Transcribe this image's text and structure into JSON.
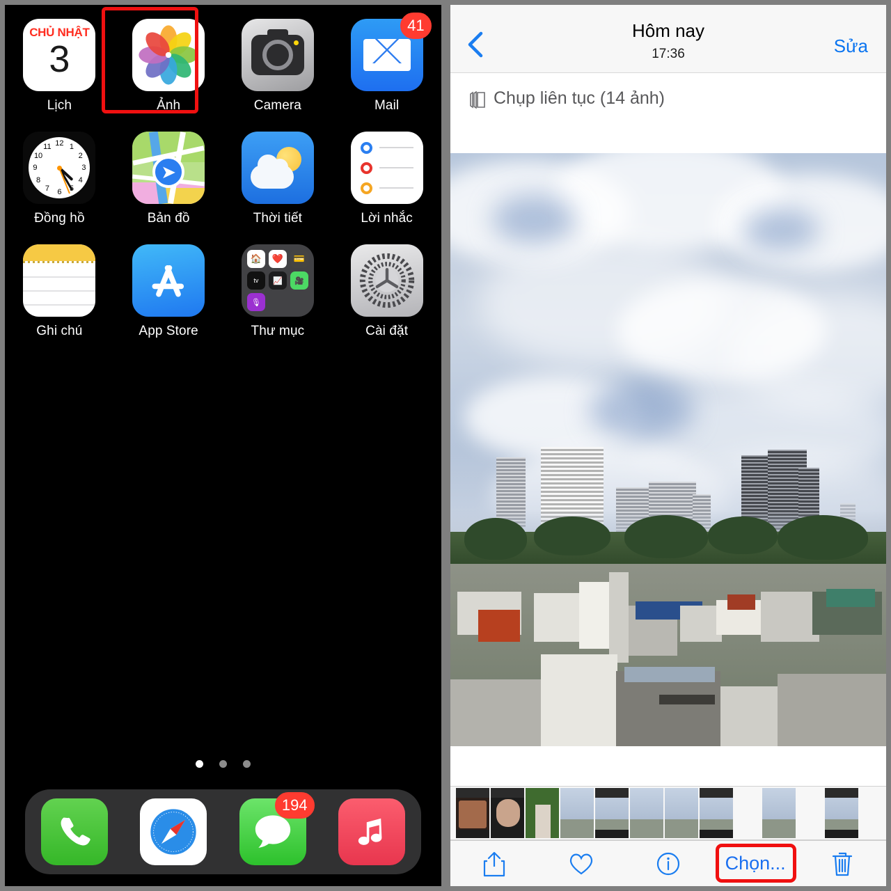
{
  "home_screen": {
    "apps": [
      [
        {
          "id": "calendar",
          "label": "Lịch",
          "icon": "calendar-icon",
          "day_of_week": "CHỦ NHẬT",
          "day_number": "3",
          "badge": null,
          "highlighted": false
        },
        {
          "id": "photos",
          "label": "Ảnh",
          "icon": "photos-icon",
          "badge": null,
          "highlighted": true
        },
        {
          "id": "camera",
          "label": "Camera",
          "icon": "camera-icon",
          "badge": null,
          "highlighted": false
        },
        {
          "id": "mail",
          "label": "Mail",
          "icon": "mail-icon",
          "badge": "41",
          "highlighted": false
        }
      ],
      [
        {
          "id": "clock",
          "label": "Đồng hồ",
          "icon": "clock-icon",
          "badge": null,
          "highlighted": false
        },
        {
          "id": "maps",
          "label": "Bản đồ",
          "icon": "maps-icon",
          "badge": null,
          "highlighted": false
        },
        {
          "id": "weather",
          "label": "Thời tiết",
          "icon": "weather-icon",
          "badge": null,
          "highlighted": false
        },
        {
          "id": "reminders",
          "label": "Lời nhắc",
          "icon": "reminders-icon",
          "badge": null,
          "highlighted": false
        }
      ],
      [
        {
          "id": "notes",
          "label": "Ghi chú",
          "icon": "notes-icon",
          "badge": null,
          "highlighted": false
        },
        {
          "id": "appstore",
          "label": "App Store",
          "icon": "app-store-icon",
          "badge": null,
          "highlighted": false
        },
        {
          "id": "folder",
          "label": "Thư mục",
          "icon": "folder-icon",
          "badge": null,
          "highlighted": false,
          "contents": [
            "home-icon",
            "health-icon",
            "wallet-icon",
            "apple-tv-icon",
            "stocks-icon",
            "facetime-icon",
            "podcasts-icon"
          ]
        },
        {
          "id": "settings",
          "label": "Cài đặt",
          "icon": "settings-gear-icon",
          "badge": null,
          "highlighted": false
        }
      ]
    ],
    "page_dots": {
      "count": 3,
      "active_index": 0
    },
    "dock": [
      {
        "id": "phone",
        "icon": "phone-icon",
        "badge": null
      },
      {
        "id": "safari",
        "icon": "safari-compass-icon",
        "badge": null
      },
      {
        "id": "messages",
        "icon": "messages-bubble-icon",
        "badge": "194"
      },
      {
        "id": "music",
        "icon": "music-note-icon",
        "badge": null
      }
    ],
    "clock_time": {
      "hour": 4,
      "minute": 25
    }
  },
  "photos_app": {
    "nav": {
      "back_icon": "chevron-left-icon",
      "title": "Hôm nay",
      "subtitle": "17:36",
      "edit_label": "Sửa"
    },
    "burst": {
      "icon": "burst-stack-icon",
      "label": "Chụp liên tục (14 ảnh)"
    },
    "photo": {
      "description": "Cityscape with clouds over Ho Chi Minh City skyline"
    },
    "thumbnails": [
      {
        "type": "portrait-dark"
      },
      {
        "type": "portrait-dark"
      },
      {
        "type": "portrait-green"
      },
      {
        "type": "city"
      },
      {
        "type": "city-bar"
      },
      {
        "type": "city"
      },
      {
        "type": "city"
      },
      {
        "type": "city-bar"
      },
      {
        "type": "city",
        "gap_before": true
      },
      {
        "type": "city-bar",
        "gap_before": true
      }
    ],
    "toolbar": [
      {
        "id": "share",
        "icon": "share-icon",
        "label": null,
        "highlighted": false
      },
      {
        "id": "favorite",
        "icon": "heart-icon",
        "label": null,
        "highlighted": false
      },
      {
        "id": "info",
        "icon": "info-circle-icon",
        "label": null,
        "highlighted": false
      },
      {
        "id": "select",
        "icon": null,
        "label": "Chọn...",
        "highlighted": true
      },
      {
        "id": "delete",
        "icon": "trash-icon",
        "label": null,
        "highlighted": false
      }
    ]
  },
  "colors": {
    "ios_blue": "#0a74f0",
    "highlight_red": "#f01010",
    "badge_red": "#ff3b30",
    "nav_bg": "#f7f7f7"
  }
}
